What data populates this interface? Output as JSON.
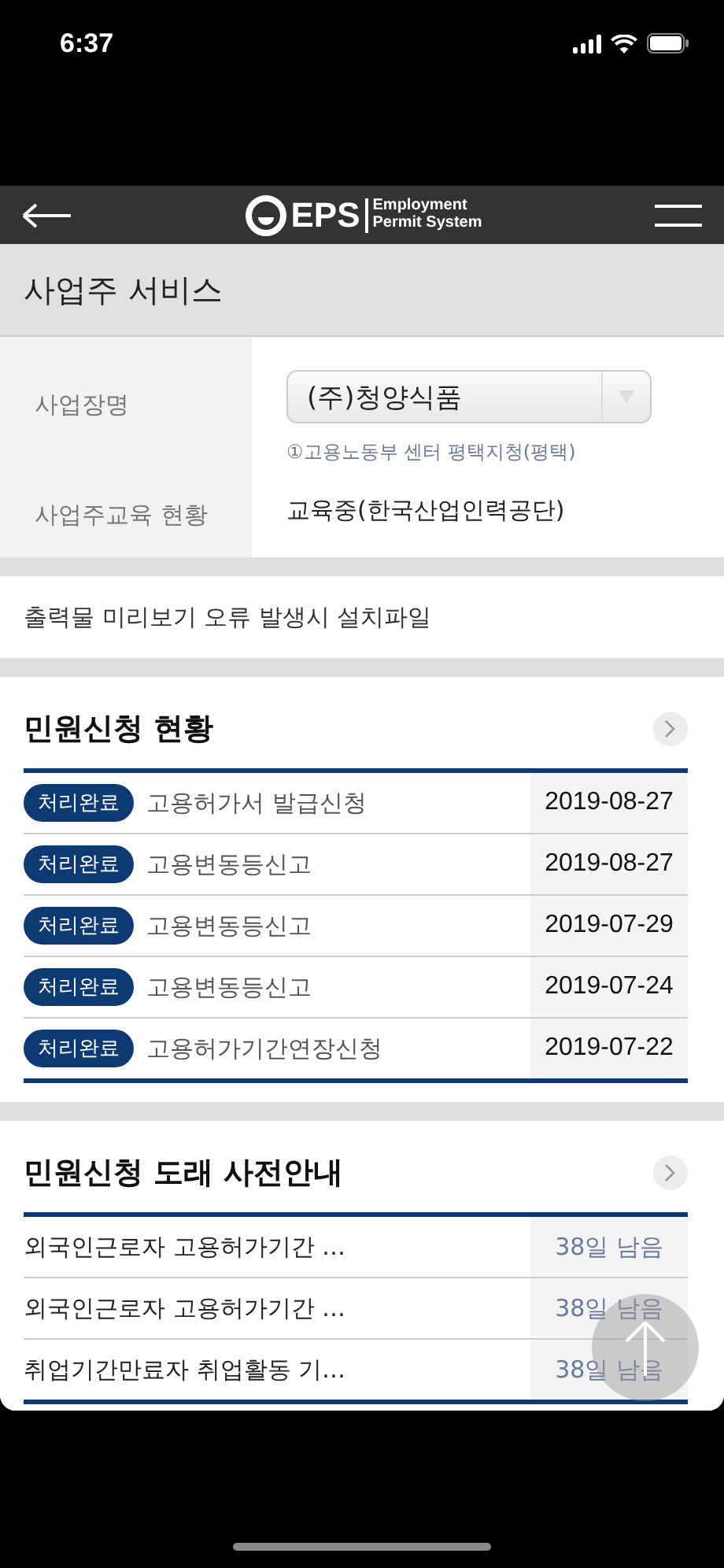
{
  "status_bar": {
    "time": "6:37"
  },
  "header": {
    "logo": "EPS",
    "logo_line1": "Employment",
    "logo_line2": "Permit System"
  },
  "page_title": "사업주 서비스",
  "info": [
    {
      "label": "사업장명",
      "kind": "select",
      "value": "(주)청양식품",
      "note": "①고용노동부 센터 평택지청(평택)"
    },
    {
      "label": "사업주교육 현황",
      "kind": "text",
      "value": "교육중(한국산업인력공단)"
    }
  ],
  "download_link": "출력물 미리보기 오류 발생시 설치파일",
  "applications": {
    "title": "민원신청 현황",
    "rows": [
      {
        "status": "처리완료",
        "name": "고용허가서 발급신청",
        "date": "2019-08-27"
      },
      {
        "status": "처리완료",
        "name": "고용변동등신고",
        "date": "2019-08-27"
      },
      {
        "status": "처리완료",
        "name": "고용변동등신고",
        "date": "2019-07-29"
      },
      {
        "status": "처리완료",
        "name": "고용변동등신고",
        "date": "2019-07-24"
      },
      {
        "status": "처리완료",
        "name": "고용허가기간연장신청",
        "date": "2019-07-22"
      }
    ]
  },
  "notices": {
    "title": "민원신청 도래 사전안내",
    "rows": [
      {
        "name": "외국인근로자 고용허가기간 …",
        "remaining": "38일 남음"
      },
      {
        "name": "외국인근로자 고용허가기간 …",
        "remaining": "38일 남음"
      },
      {
        "name": "취업기간만료자 취업활동 기…",
        "remaining": "38일 남음"
      }
    ]
  }
}
